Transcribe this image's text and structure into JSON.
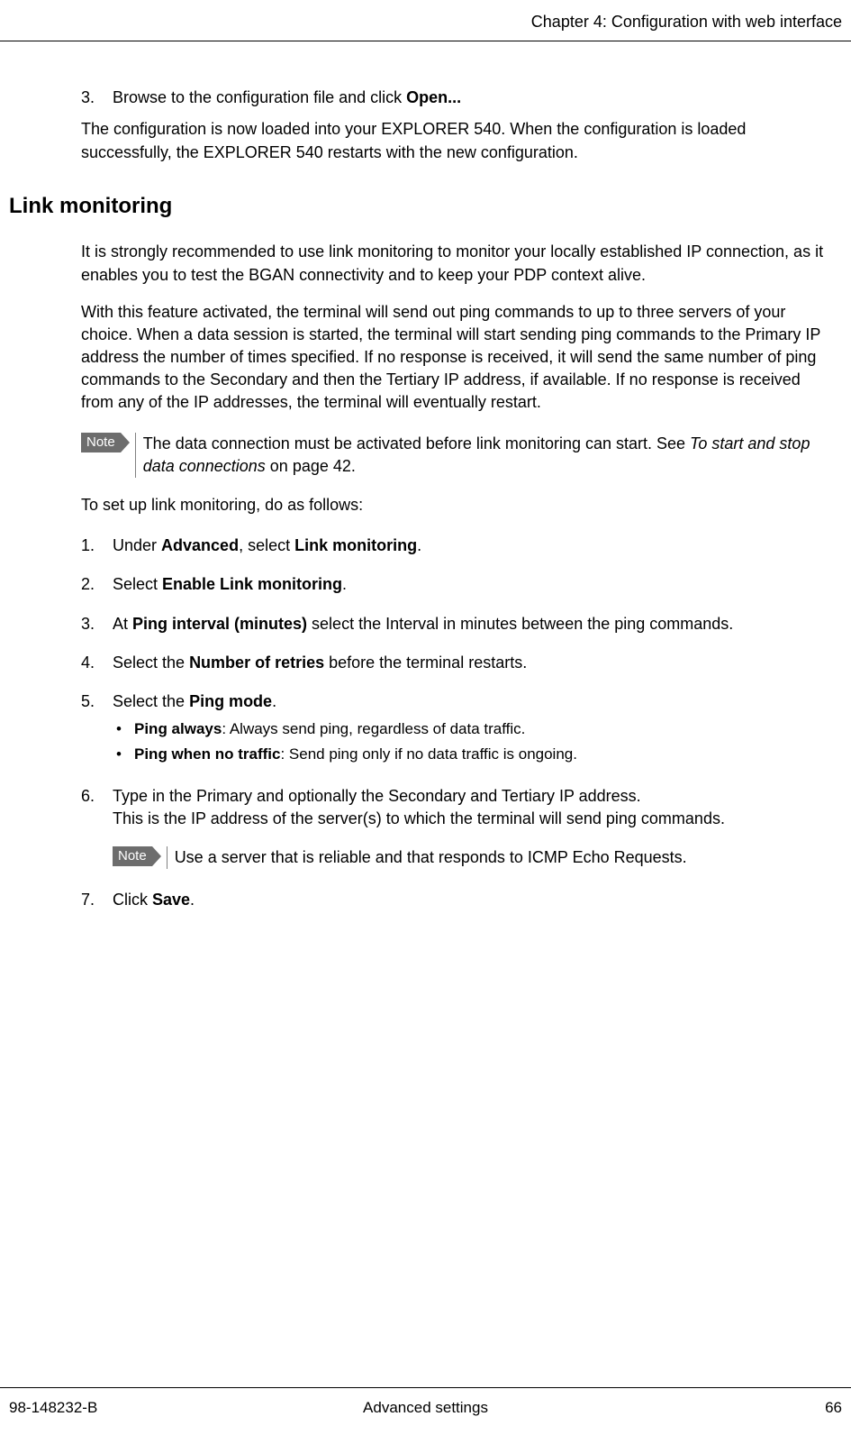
{
  "header": {
    "chapter": "Chapter 4: Configuration with web interface"
  },
  "intro_step": {
    "num": "3.",
    "text_before": "Browse to the configuration file and click ",
    "bold": "Open...",
    "text_after": ""
  },
  "intro_para": "The configuration is now loaded into your EXPLORER 540. When the configuration is loaded successfully, the EXPLORER 540 restarts with the new configuration.",
  "section_heading": "Link monitoring",
  "para1": "It is strongly recommended to use link monitoring to monitor your locally established IP connection, as it enables you to test the BGAN connectivity and to keep your PDP context alive.",
  "para2": "With this feature activated, the terminal will send out ping commands to up to three servers of your choice. When a data session is started, the terminal will start sending ping commands to the Primary IP address the number of times specified. If no response is received, it will send the same number of ping commands to the Secondary and then the Tertiary IP address, if available. If no response is received from any of the IP addresses, the terminal will eventually restart.",
  "note1": {
    "label": "Note",
    "text_before": "The data connection must be activated before link monitoring can start. See ",
    "italic": "To start and stop data connections",
    "text_after": " on page 42."
  },
  "setup_intro": "To set up link monitoring, do as follows:",
  "steps": [
    {
      "num": "1.",
      "parts": [
        {
          "t": "Under ",
          "b": false
        },
        {
          "t": "Advanced",
          "b": true
        },
        {
          "t": ", select ",
          "b": false
        },
        {
          "t": "Link monitoring",
          "b": true
        },
        {
          "t": ".",
          "b": false
        }
      ]
    },
    {
      "num": "2.",
      "parts": [
        {
          "t": "Select ",
          "b": false
        },
        {
          "t": "Enable Link monitoring",
          "b": true
        },
        {
          "t": ".",
          "b": false
        }
      ]
    },
    {
      "num": "3.",
      "parts": [
        {
          "t": "At ",
          "b": false
        },
        {
          "t": "Ping interval (minutes)",
          "b": true
        },
        {
          "t": " select the Interval in minutes between the ping commands.",
          "b": false
        }
      ]
    },
    {
      "num": "4.",
      "parts": [
        {
          "t": "Select the ",
          "b": false
        },
        {
          "t": "Number of retries",
          "b": true
        },
        {
          "t": " before the terminal restarts.",
          "b": false
        }
      ]
    },
    {
      "num": "5.",
      "parts": [
        {
          "t": "Select the ",
          "b": false
        },
        {
          "t": "Ping mode",
          "b": true
        },
        {
          "t": ".",
          "b": false
        }
      ],
      "bullets": [
        {
          "bold": "Ping always",
          "rest": ": Always send ping, regardless of data traffic."
        },
        {
          "bold": "Ping when no traffic",
          "rest": ": Send ping only if no data traffic is ongoing."
        }
      ]
    },
    {
      "num": "6.",
      "parts": [
        {
          "t": "Type in the Primary and optionally the Secondary and Tertiary IP address.",
          "b": false
        }
      ],
      "line2": "This is the IP address of the server(s) to which the terminal will send ping commands.",
      "note": {
        "label": "Note",
        "text": "Use a server that is reliable and that responds to ICMP Echo Requests."
      }
    },
    {
      "num": "7.",
      "parts": [
        {
          "t": "Click ",
          "b": false
        },
        {
          "t": "Save",
          "b": true
        },
        {
          "t": ".",
          "b": false
        }
      ]
    }
  ],
  "footer": {
    "left": "98-148232-B",
    "center": "Advanced settings",
    "right": "66"
  }
}
